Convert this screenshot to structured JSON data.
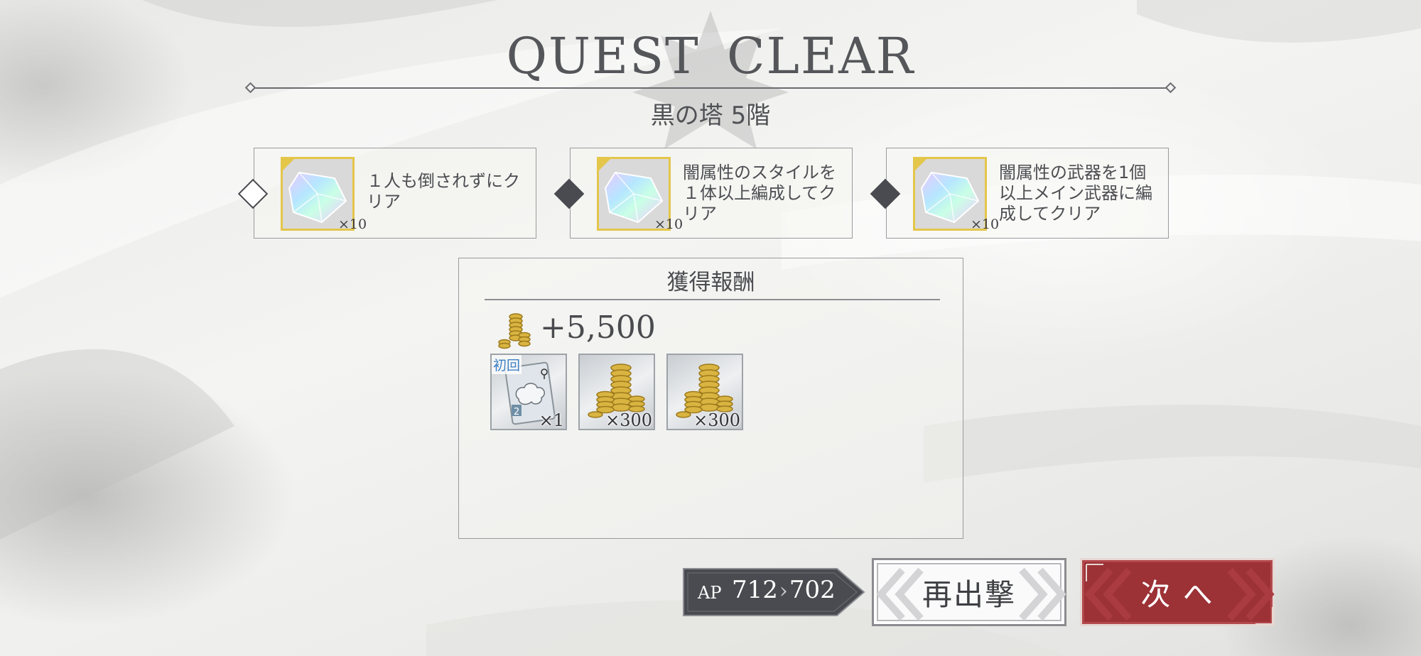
{
  "header": {
    "title": "QUEST  CLEAR",
    "subtitle": "黒の塔 5階"
  },
  "missions": [
    {
      "text": "１人も倒されずにクリア",
      "reward_quantity": "×10",
      "reward_icon": "crystal-icon",
      "completed_marker": "outline"
    },
    {
      "text": "闇属性のスタイルを１体以上編成してクリア",
      "reward_quantity": "×10",
      "reward_icon": "crystal-icon",
      "completed_marker": "filled"
    },
    {
      "text": "闇属性の武器を1個以上メイン武器に編成してクリア",
      "reward_quantity": "×10",
      "reward_icon": "crystal-icon",
      "completed_marker": "filled"
    }
  ],
  "rewards": {
    "heading": "獲得報酬",
    "gold_icon": "gold-coins-icon",
    "gold_amount": "+5,500",
    "items": [
      {
        "icon": "cloud-card-icon",
        "tag": "初回",
        "quantity": "×1"
      },
      {
        "icon": "gold-coins-icon",
        "quantity": "×300"
      },
      {
        "icon": "gold-coins-icon",
        "quantity": "×300"
      }
    ]
  },
  "ap": {
    "label": "AP",
    "current": "712",
    "after": "702"
  },
  "buttons": {
    "retry": "再出撃",
    "next": "次 へ"
  },
  "colors": {
    "next_button": "#9c3136",
    "ap_badge": "#4a4b50",
    "text": "#4a4a4e"
  }
}
